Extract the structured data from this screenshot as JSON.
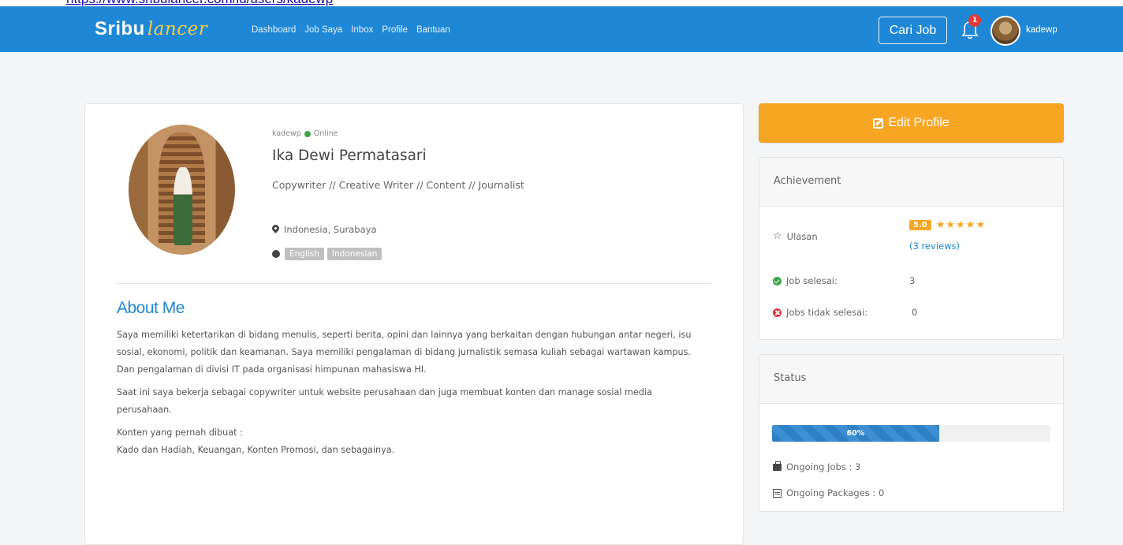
{
  "browser": {
    "url_text": "https://www.sribulancer.com/id/users/kadewp"
  },
  "navbar": {
    "brand_main": "Sribu",
    "brand_accent": "lancer",
    "links": [
      "Dashboard",
      "Job Saya",
      "Inbox",
      "Profile",
      "Bantuan"
    ],
    "search_button": "Cari Job",
    "notification_count": "1",
    "username": "kadewp"
  },
  "profile": {
    "username": "kadewp",
    "status": "Online",
    "full_name": "Ika Dewi Permatasari",
    "headline": "Copywriter // Creative Writer // Content // Journalist",
    "location": "Indonesia, Surabaya",
    "languages": [
      "English",
      "Indonesian"
    ]
  },
  "about": {
    "title": "About Me",
    "paragraphs": [
      "Saya memiliki ketertarikan di bidang menulis, seperti berita, opini dan lainnya yang berkaitan dengan hubungan antar negeri, isu sosial, ekonomi, politik dan keamanan. Saya memiliki pengalaman di bidang jurnalistik semasa kuliah sebagai wartawan kampus. Dan pengalaman di divisi IT pada organisasi himpunan mahasiswa HI.",
      "Saat ini saya bekerja sebagai copywriter untuk website perusahaan dan juga membuat konten dan manage sosial media perusahaan.",
      "Konten yang pernah dibuat :",
      "Kado dan Hadiah, Keuangan, Konten Promosi, dan sebagainya."
    ]
  },
  "sidebar": {
    "edit_button": "Edit Profile",
    "achievement": {
      "title": "Achievement",
      "ulasan_label": "Ulasan",
      "rating": "5.0",
      "stars": 5,
      "reviews": "(3 reviews)",
      "job_selesai_label": "Job selesai:",
      "job_selesai_value": "3",
      "jobs_tidak_selesai_label": "Jobs tidak selesai:",
      "jobs_tidak_selesai_value": "0"
    },
    "status": {
      "title": "Status",
      "progress_percent": 60,
      "progress_label": "60%",
      "ongoing_jobs": "Ongoing Jobs : 3",
      "ongoing_packages": "Ongoing Packages : 0"
    }
  },
  "colors": {
    "primary": "#1e88d6",
    "accent": "#f6a623",
    "online": "#3ba54a",
    "danger": "#d9383a"
  }
}
